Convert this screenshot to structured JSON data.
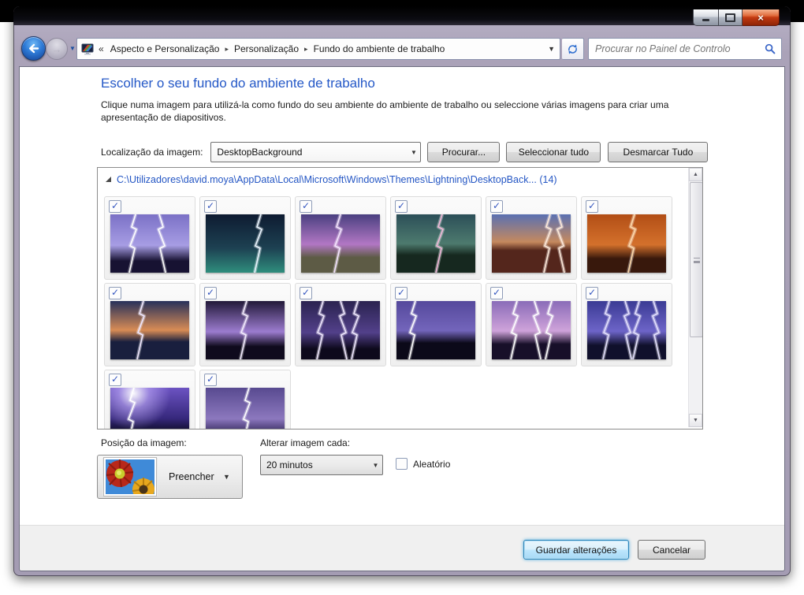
{
  "colors": {
    "frame": "#aaa2b8",
    "titlebar": "#000000",
    "heading_blue": "#2458c7",
    "path_blue": "#2456c4",
    "close_red": "#c33a12",
    "back_blue": "#2e7ad6",
    "default_button_glow": "#57b0e0",
    "footer_gray": "#f0f0f0"
  },
  "window": {
    "caption": {
      "minimize": "minimize",
      "maximize": "maximize",
      "close": "×"
    }
  },
  "navbar": {
    "breadcrumb": {
      "overflow": "«",
      "items": [
        "Aspecto e Personalização",
        "Personalização",
        "Fundo do ambiente de trabalho"
      ],
      "separator": "▸"
    },
    "search": {
      "placeholder": "Procurar no Painel de Controlo"
    }
  },
  "main": {
    "heading": "Escolher o seu fundo do ambiente de trabalho",
    "description": "Clique numa imagem para utilizá-la como fundo do seu ambiente do ambiente de trabalho ou seleccione várias imagens para criar uma apresentação de diapositivos.",
    "location": {
      "label": "Localização da imagem:",
      "combo_value": "DesktopBackground",
      "browse_button": "Procurar...",
      "select_all_button": "Seleccionar tudo",
      "clear_all_button": "Desmarcar Tudo"
    }
  },
  "gallery": {
    "path": "C:\\Utilizadores\\david.moya\\AppData\\Local\\Microsoft\\Windows\\Themes\\Lightning\\DesktopBack... (14)",
    "image_count": 14,
    "all_checked": true,
    "check_glyph": "✓",
    "tiles": [
      {
        "sky": "#7b71c6",
        "glow": "#a79de4",
        "ground": "#171232",
        "ground_h": 20,
        "bolts": [
          32,
          62
        ],
        "bolt_color": "#ffffff"
      },
      {
        "sky": "#0e1b31",
        "glow": "#1d4152",
        "ground": "#2f8e7d",
        "ground_h": 0,
        "bolts": [
          70
        ],
        "bolt_color": "#e8f4ff"
      },
      {
        "sky": "#4a4080",
        "glow": "#b277c4",
        "ground": "#5d5b45",
        "ground_h": 26,
        "bolts": [
          50
        ],
        "bolt_color": "#f4e2ff"
      },
      {
        "sky": "#2c4f58",
        "glow": "#4d7a6e",
        "ground": "#16281f",
        "ground_h": 30,
        "bolts": [
          58
        ],
        "bolt_color": "#f2b6d8"
      },
      {
        "sky": "#5a70b2",
        "glow": "#c5895e",
        "ground": "#54261c",
        "ground_h": 38,
        "bolts": [
          74,
          84
        ],
        "bolt_color": "#ffe9d8"
      },
      {
        "sky": "#b24e16",
        "glow": "#d4712c",
        "ground": "#38180c",
        "ground_h": 24,
        "bolts": [
          60
        ],
        "bolt_color": "#ffd9a8"
      },
      {
        "sky": "#27315a",
        "glow": "#d88c55",
        "ground": "#191f3e",
        "ground_h": 30,
        "bolts": [
          42
        ],
        "bolt_color": "#efe6ff"
      },
      {
        "sky": "#221939",
        "glow": "#9c7ccf",
        "ground": "#0f0a1d",
        "ground_h": 22,
        "bolts": [
          52
        ],
        "bolt_color": "#f3eaff"
      },
      {
        "sky": "#2b2350",
        "glow": "#52408a",
        "ground": "#0d091c",
        "ground_h": 18,
        "bolts": [
          28,
          50,
          72
        ],
        "bolt_color": "#efe6ff"
      },
      {
        "sky": "#55499c",
        "glow": "#7365bb",
        "ground": "#0b0919",
        "ground_h": 28,
        "bolts": [
          24
        ],
        "bolt_color": "#ffffff"
      },
      {
        "sky": "#8a6cb8",
        "glow": "#cfa3da",
        "ground": "#170f29",
        "ground_h": 26,
        "bolts": [
          32,
          54,
          76
        ],
        "bolt_color": "#ffffff"
      },
      {
        "sky": "#3b3b94",
        "glow": "#6d64c8",
        "ground": "#10102c",
        "ground_h": 24,
        "bolts": [
          28,
          48,
          66,
          84
        ],
        "bolt_color": "#e4e0ff"
      },
      {
        "sky": "#6c53c2",
        "glow": "#36287c",
        "ground": "#0a0a1f",
        "ground_h": 22,
        "bolts": [
          30
        ],
        "bolt_color": "#ffffff",
        "flash": true
      },
      {
        "sky": "#584a90",
        "glow": "#8c78be",
        "ground": "#2c2254",
        "ground_h": 20,
        "bolts": [
          55
        ],
        "bolt_color": "#ffffff"
      }
    ]
  },
  "lower": {
    "position_label": "Posição da imagem:",
    "position_value": "Preencher",
    "change_label": "Alterar imagem cada:",
    "interval_value": "20 minutos",
    "random_label": "Aleatório",
    "random_checked": false
  },
  "footer": {
    "save_button": "Guardar alterações",
    "cancel_button": "Cancelar"
  }
}
